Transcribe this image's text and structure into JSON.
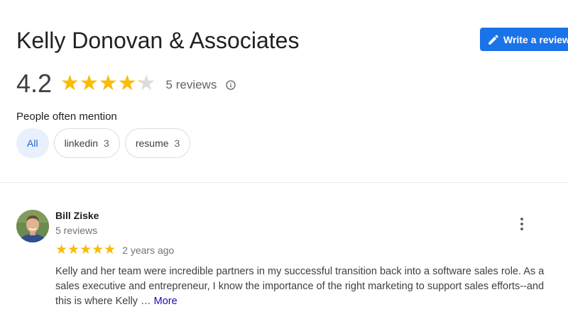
{
  "business": {
    "name": "Kelly Donovan & Associates",
    "rating": 4.2,
    "rating_display": "4.2",
    "reviews_label": "5 reviews",
    "star_glyphs": "★★★★★"
  },
  "actions": {
    "write_review_label": "Write a review"
  },
  "mentions": {
    "label": "People often mention",
    "chips": [
      {
        "label": "All",
        "count": "",
        "active": true
      },
      {
        "label": "linkedin",
        "count": "3",
        "active": false
      },
      {
        "label": "resume",
        "count": "3",
        "active": false
      }
    ]
  },
  "reviews": [
    {
      "author": "Bill Ziske",
      "author_meta": "5 reviews",
      "rating": 5,
      "star_glyphs": "★★★★★",
      "date": "2 years ago",
      "text": "Kelly and her team were incredible partners in my successful transition back into a software sales role. As a sales executive and entrepreneur, I know the importance of the right marketing to support sales efforts--and this is where Kelly … ",
      "more_label": "More"
    }
  ],
  "colors": {
    "accent": "#1a73e8",
    "star": "#fbbc04",
    "star_empty": "#dadce0",
    "chip_active_bg": "#e8f0fe",
    "link": "#1a0dab"
  },
  "icons": {
    "write_review": "pencil-icon",
    "info": "info-icon",
    "menu": "more-vert-icon"
  }
}
